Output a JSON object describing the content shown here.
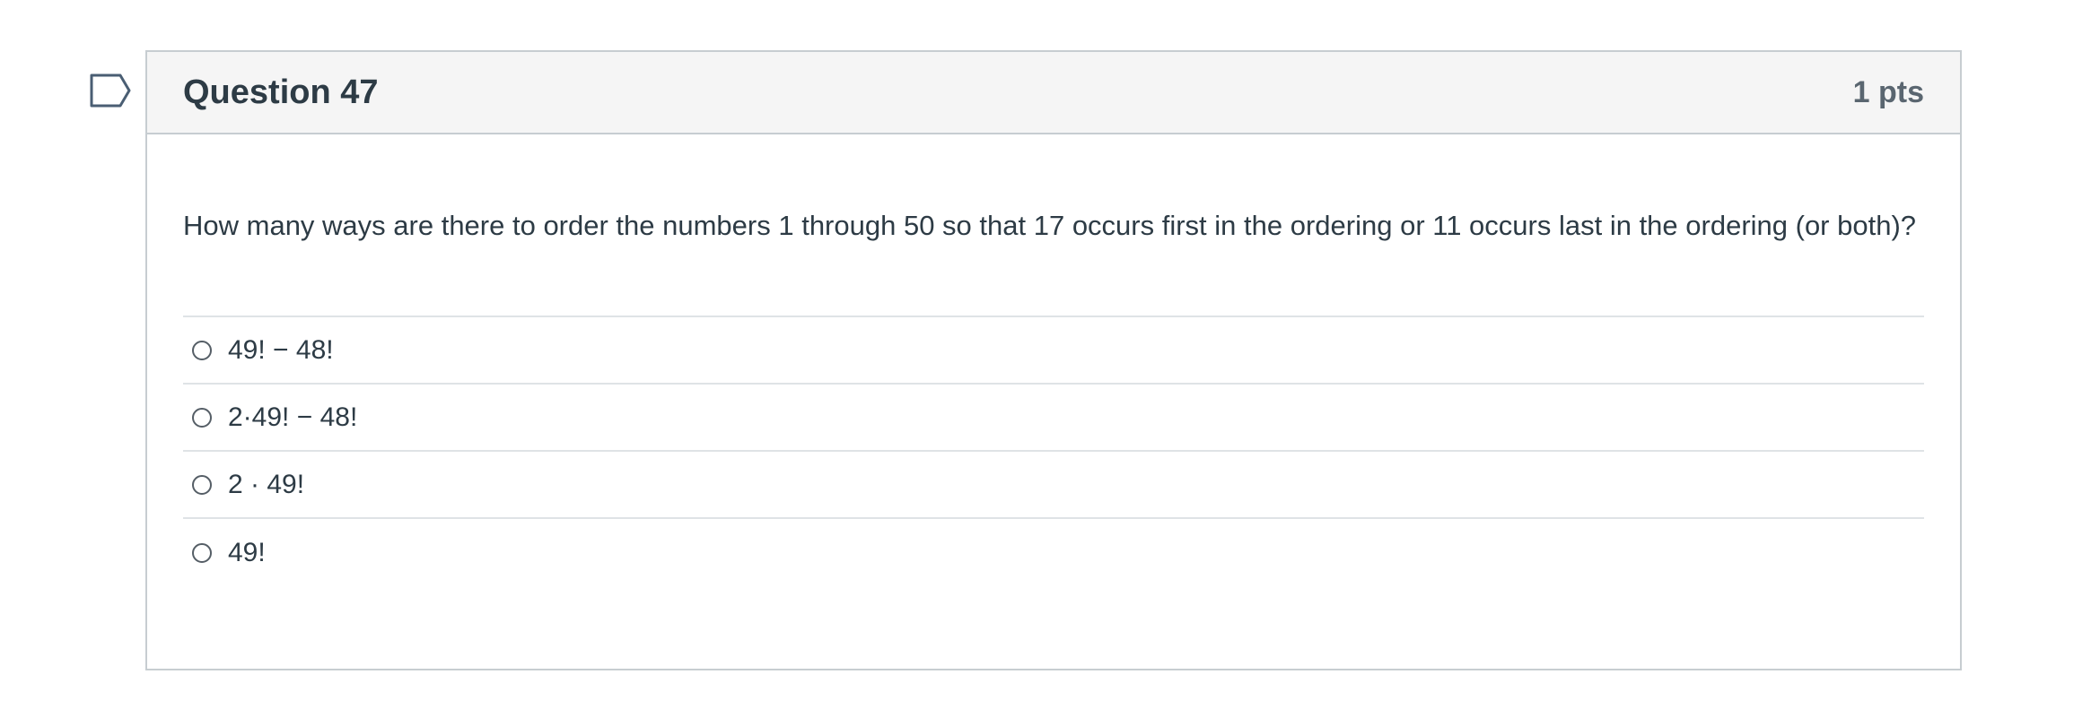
{
  "question": {
    "title": "Question 47",
    "points": "1 pts",
    "text": "How many ways are there to order the numbers 1 through 50 so that 17 occurs first in the ordering or 11 occurs last in the ordering (or both)?",
    "answers": [
      {
        "label": "49! − 48!"
      },
      {
        "label": "2·49! − 48!"
      },
      {
        "label": "2 · 49!"
      },
      {
        "label": "49!"
      }
    ]
  },
  "colors": {
    "header_bg": "#f5f5f5",
    "border": "#c7cdd1",
    "text": "#2d3b45",
    "points_text": "#5a6670",
    "flag_outline": "#4a5e73"
  },
  "icons": {
    "flag": "flag-question-icon",
    "radio": "radio-unselected-icon"
  }
}
